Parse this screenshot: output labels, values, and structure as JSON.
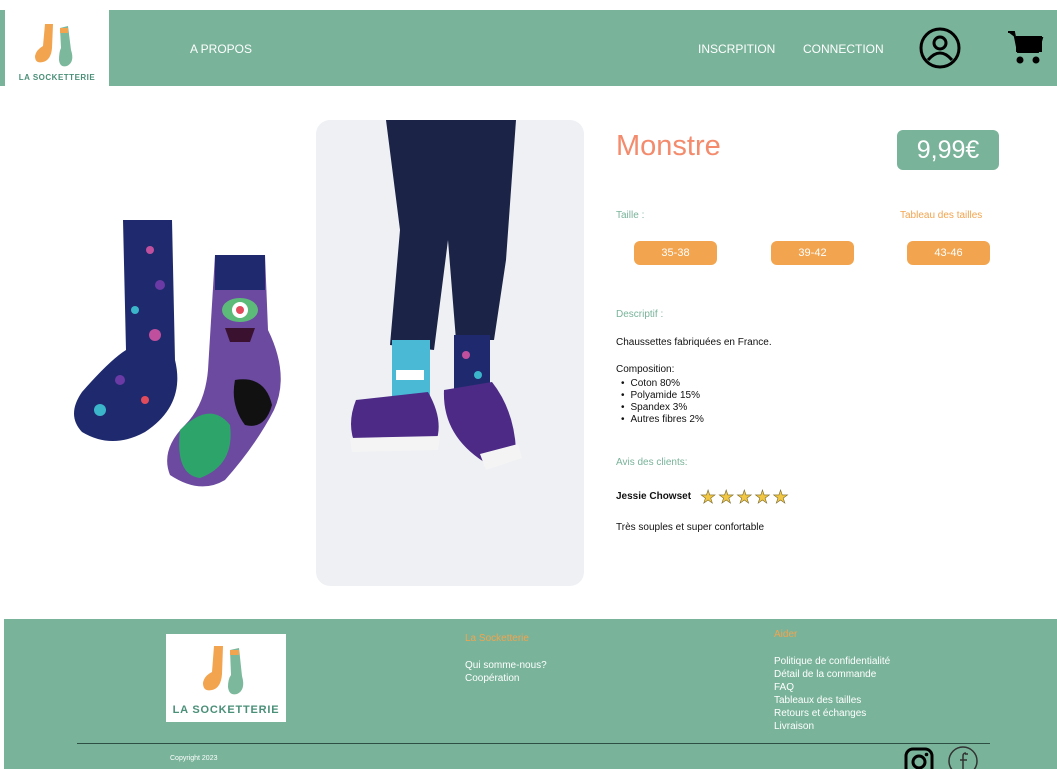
{
  "header": {
    "logo_text": "LA SOCKETTERIE",
    "nav_about": "A PROPOS",
    "nav_signup": "INSCRPITION",
    "nav_login": "CONNECTION",
    "account_icon": "user-circle-icon",
    "cart_icon": "cart-icon"
  },
  "product": {
    "title": "Monstre",
    "price": "9,99€",
    "size_label": "Taille :",
    "size_chart_link": "Tableau des tailles",
    "sizes": [
      "35-38",
      "39-42",
      "43-46"
    ],
    "description_label": "Descriptif :",
    "description": "Chaussettes fabriquées en France.",
    "composition_label": "Composition:",
    "composition": [
      "Coton 80%",
      "Polyamide 15%",
      "Spandex 3%",
      "Autres fibres 2%"
    ],
    "reviews_label": "Avis des clients:",
    "review": {
      "author": "Jessie Chowset",
      "rating": 5,
      "stars": "★★★★★",
      "text": "Très souples et super confortable"
    }
  },
  "footer": {
    "logo_text": "LA SOCKETTERIE",
    "col1_title": "La Socketterie",
    "col1_links": [
      "Qui somme-nous?",
      "Coopération"
    ],
    "col2_title": "Aider",
    "col2_links": [
      "Politique de confidentialité",
      "Détail de la commande",
      "FAQ",
      "Tableaux des tailles",
      "Retours et échanges",
      "Livraison"
    ],
    "copyright": "Copyright  2023",
    "social_icons": [
      "instagram-icon",
      "facebook-icon"
    ]
  },
  "colors": {
    "brand_green": "#79b39a",
    "accent_orange": "#f2a44e",
    "title_salmon": "#f38b6c"
  }
}
